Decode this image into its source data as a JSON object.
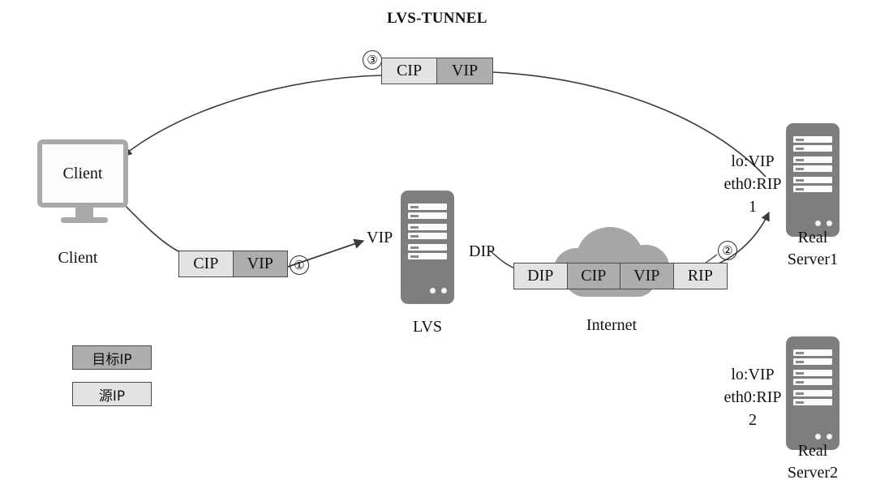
{
  "diagram": {
    "title": "LVS-TUNNEL"
  },
  "nodes": {
    "client": {
      "screen_label": "Client",
      "caption": "Client"
    },
    "lvs": {
      "caption": "LVS",
      "ingress_label": "VIP",
      "egress_label": "DIP"
    },
    "internet": {
      "caption": "Internet"
    },
    "real_server_1": {
      "caption_line1": "Real",
      "caption_line2": "Server1",
      "interfaces": "lo:VIP\neth0:RIP\n1"
    },
    "real_server_2": {
      "caption_line1": "Real",
      "caption_line2": "Server2",
      "interfaces": "lo:VIP\neth0:RIP\n2"
    }
  },
  "packets": {
    "reply_top": {
      "step": "③",
      "cells": [
        {
          "text": "CIP",
          "role": "src"
        },
        {
          "text": "VIP",
          "role": "dst"
        }
      ]
    },
    "request_client": {
      "step": "①",
      "cells": [
        {
          "text": "CIP",
          "role": "src"
        },
        {
          "text": "VIP",
          "role": "dst"
        }
      ]
    },
    "tunnel": {
      "step": "②",
      "cells": [
        {
          "text": "DIP",
          "role": "src"
        },
        {
          "text": "CIP",
          "role": "dst"
        },
        {
          "text": "VIP",
          "role": "dst"
        },
        {
          "text": "RIP",
          "role": "src"
        }
      ]
    }
  },
  "legend": {
    "destination": "目标IP",
    "source": "源IP"
  },
  "colors": {
    "destination_fill": "#adadad",
    "source_fill": "#e3e3e3",
    "device_gray": "#7e7e7e",
    "cloud_gray": "#a6a6a6",
    "line": "#3a3a3a"
  }
}
